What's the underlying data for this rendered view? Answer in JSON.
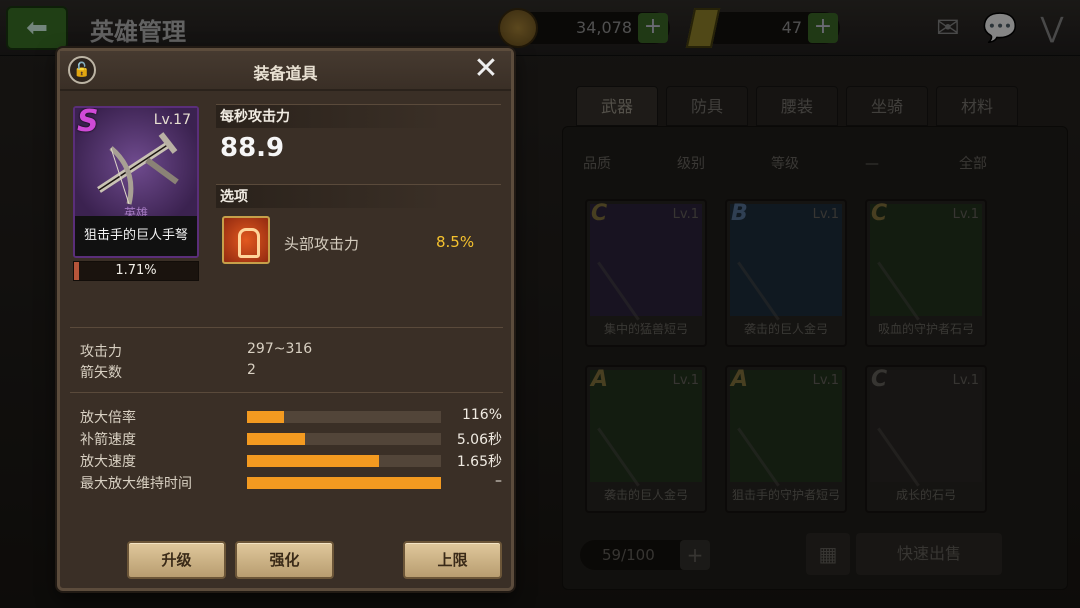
{
  "header": {
    "title": "英雄管理",
    "gold": "34,078",
    "tickets": "47",
    "plus_glyph": "+",
    "icons": [
      "mail-icon",
      "chat-icon",
      "collapse-icon"
    ]
  },
  "inventory": {
    "tabs": [
      "武器",
      "防具",
      "腰装",
      "坐骑",
      "材料"
    ],
    "active_tab": "武器",
    "filters": [
      "品质",
      "级别",
      "等级",
      "—",
      "全部"
    ],
    "cards": [
      {
        "grade": "C",
        "level": "Lv.1",
        "name": "集中的猛兽短弓"
      },
      {
        "grade": "B",
        "level": "Lv.1",
        "name": "袭击的巨人金弓"
      },
      {
        "grade": "C",
        "level": "Lv.1",
        "name": "吸血的守护者石弓"
      },
      {
        "grade": "A",
        "level": "Lv.1",
        "name": "袭击的巨人金弓"
      },
      {
        "grade": "A",
        "level": "Lv.1",
        "name": "狙击手的守护者短弓"
      },
      {
        "grade": "C",
        "level": "Lv.1",
        "name": "成长的石弓"
      }
    ],
    "count": "59/100",
    "quick_sell": "快速出售"
  },
  "modal": {
    "title": "装备道具",
    "item": {
      "grade": "S",
      "level": "Lv.17",
      "rarity": "英雄",
      "name": "狙击手的巨人手弩",
      "progress_text": "1.71%",
      "progress_fraction": 0.0171
    },
    "dps_label": "每秒攻击力",
    "dps_value": "88.9",
    "options_label": "选项",
    "option": {
      "name": "头部攻击力",
      "value": "8.5%"
    },
    "stats": [
      {
        "label": "攻击力",
        "value": "297~316"
      },
      {
        "label": "箭矢数",
        "value": "2"
      }
    ],
    "bars": [
      {
        "label": "放大倍率",
        "value": "116%",
        "fill": 0.19
      },
      {
        "label": "补箭速度",
        "value": "5.06秒",
        "fill": 0.3
      },
      {
        "label": "放大速度",
        "value": "1.65秒",
        "fill": 0.68
      },
      {
        "label": "最大放大维持时间",
        "value": "–",
        "fill": 1.0
      }
    ],
    "buttons": {
      "upgrade": "升级",
      "enhance": "强化",
      "limit": "上限"
    }
  }
}
